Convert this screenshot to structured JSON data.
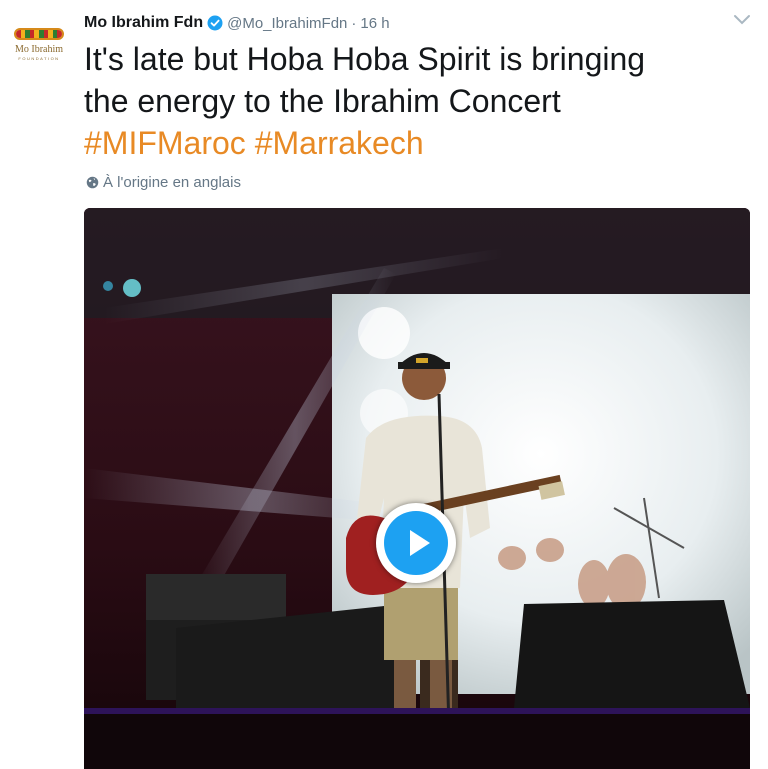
{
  "tweet": {
    "author_name": "Mo Ibrahim Fdn",
    "handle": "@Mo_IbrahimFdn",
    "separator": "·",
    "time": "16 h",
    "text_lines": [
      "It's late but Hoba Hoba Spirit is bringing",
      "the energy to the Ibrahim Concert"
    ],
    "hashtags": [
      "#MIFMaroc",
      "#Marrakech"
    ],
    "translate_label": "À l'origine en anglais"
  },
  "avatar": {
    "logo_text": "Mo Ibrahim",
    "logo_subtext": "FOUNDATION"
  },
  "icons": {
    "verified": "verified-badge-icon",
    "caret": "chevron-down-icon",
    "globe": "globe-icon",
    "play": "play-icon"
  },
  "colors": {
    "hashtag": "#e88a25",
    "verified": "#1da1f2",
    "play_button": "#1da1f2",
    "muted_text": "#657786"
  }
}
